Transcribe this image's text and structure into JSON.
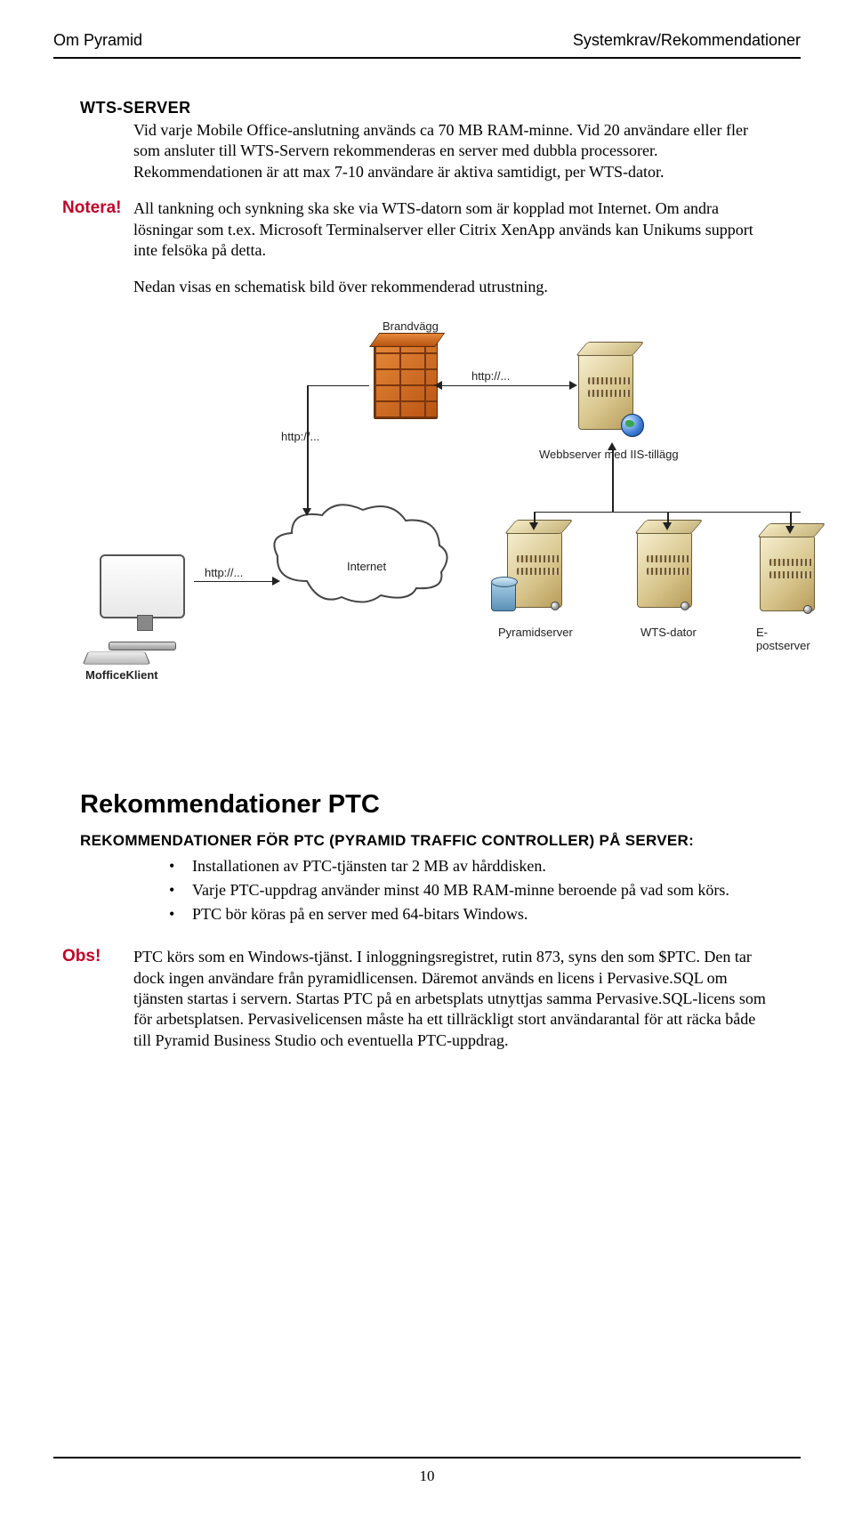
{
  "header": {
    "left": "Om Pyramid",
    "right": "Systemkrav/Rekommendationer"
  },
  "wts": {
    "title": "WTS-SERVER",
    "p1": "Vid varje Mobile Office-anslutning används ca 70 MB RAM-minne. Vid 20 användare eller fler som ansluter till WTS-Servern rekommenderas en server med dubbla processorer. Rekommendationen är att max 7-10 användare är aktiva samtidigt, per WTS-dator."
  },
  "notera": {
    "label": "Notera!",
    "body": "All tankning och synkning ska ske via WTS-datorn som är kopplad mot Internet. Om andra lösningar som t.ex. Microsoft Terminalserver eller Citrix XenApp används kan Unikums support inte felsöka på detta."
  },
  "schem_intro": "Nedan visas en schematisk bild över rekommenderad utrustning.",
  "diagram": {
    "firewall": "Brandvägg",
    "http1": "http://...",
    "http2": "http://...",
    "http3": "http://...",
    "webserver": "Webbserver med IIS-tillägg",
    "internet": "Internet",
    "pyramidserver": "Pyramidserver",
    "wtsdator": "WTS-dator",
    "epost": "E-postserver",
    "moffice": "MofficeKlient"
  },
  "ptc": {
    "heading": "Rekommendationer PTC",
    "subheading": "REKOMMENDATIONER FÖR PTC (PYRAMID TRAFFIC CONTROLLER) PÅ SERVER:",
    "bullets": [
      "Installationen av PTC-tjänsten tar 2 MB av hårddisken.",
      "Varje PTC-uppdrag använder minst 40 MB RAM-minne beroende på vad som körs.",
      "PTC bör köras på en server med 64-bitars Windows."
    ]
  },
  "obs": {
    "label": "Obs!",
    "body": "PTC körs som en Windows-tjänst. I inloggningsregistret, rutin 873, syns den som $PTC. Den tar dock ingen användare från pyramidlicensen. Däremot används en licens i Pervasive.SQL om tjänsten startas i servern. Startas PTC på en arbetsplats utnyttjas samma Pervasive.SQL-licens som för arbetsplatsen. Pervasivelicensen måste ha ett tillräckligt stort användarantal för att räcka både till Pyramid Business Studio och eventuella PTC-uppdrag."
  },
  "pagenum": "10"
}
